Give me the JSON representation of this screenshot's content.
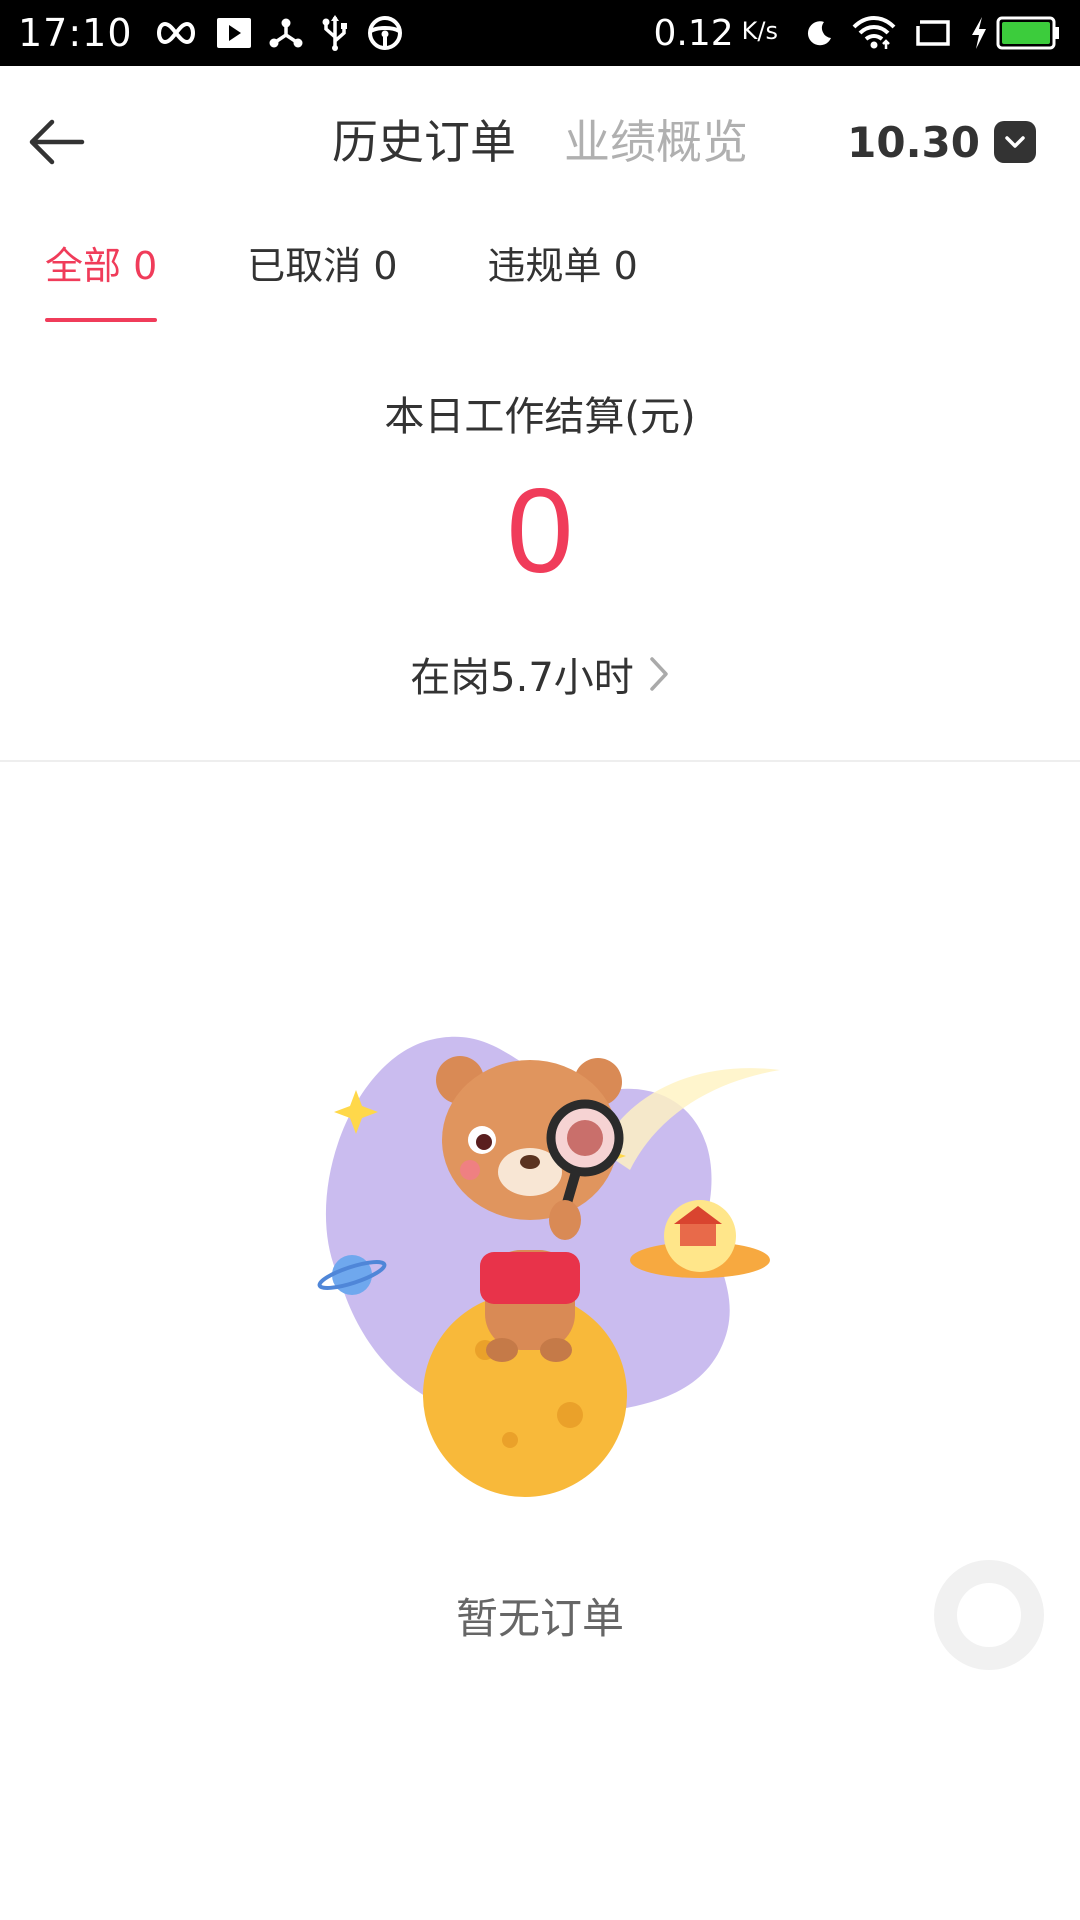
{
  "status_bar": {
    "time": "17:10",
    "net_speed": "0.12",
    "net_speed_unit": "K/s",
    "icons": [
      "infinity-icon",
      "play-icon",
      "share-node-icon",
      "usb-icon",
      "steering-wheel-icon",
      "moon-icon",
      "wifi-icon",
      "screen-rotate-icon",
      "charging-icon",
      "battery-icon"
    ],
    "battery_color": "#3ccc3c"
  },
  "header": {
    "back_icon": "arrow-left-icon",
    "tabs": [
      {
        "label": "历史订单",
        "active": true
      },
      {
        "label": "业绩概览",
        "active": false
      }
    ],
    "date": "10.30",
    "date_icon": "chevron-down-icon"
  },
  "filter_tabs": [
    {
      "label": "全部 0",
      "active": true
    },
    {
      "label": "已取消 0",
      "active": false
    },
    {
      "label": "违规单 0",
      "active": false
    }
  ],
  "settlement": {
    "title": "本日工作结算(元)",
    "amount": "0",
    "on_duty": "在岗5.7小时",
    "on_duty_icon": "chevron-right-icon"
  },
  "empty_state": {
    "illustration": "bear-with-magnifier-illustration",
    "text": "暂无订单"
  },
  "floating_button": {
    "icon": "circle-icon"
  },
  "colors": {
    "accent": "#f03c5a",
    "text_primary": "#333333",
    "text_inactive": "#b0b0b0",
    "divider": "#eeeeee"
  }
}
